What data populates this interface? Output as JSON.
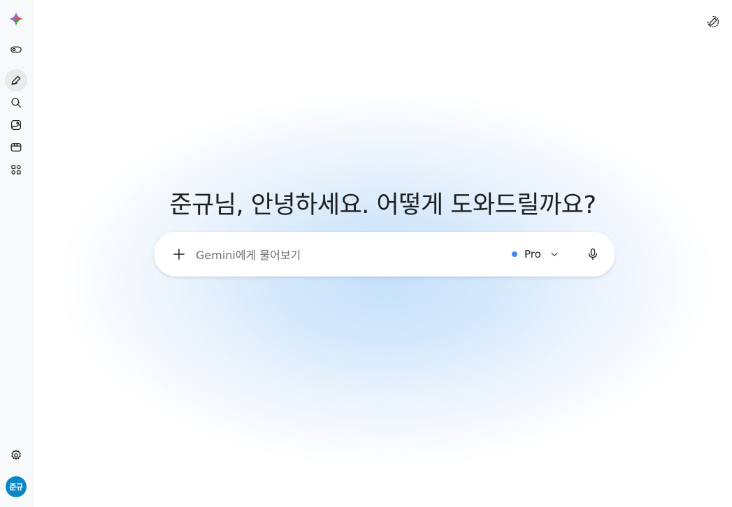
{
  "sidebar": {
    "logo_icon": "gemini-sparkle-icon",
    "items": [
      {
        "icon": "toggle-menu-icon"
      },
      {
        "icon": "new-chat-pencil-icon",
        "active": true
      },
      {
        "icon": "search-icon"
      },
      {
        "icon": "image-icon"
      },
      {
        "icon": "video-icon"
      },
      {
        "icon": "apps-icon"
      }
    ],
    "settings_icon": "gear-icon",
    "avatar_label": "준규",
    "avatar_color": "#0b87c7"
  },
  "header": {
    "temporary_chat_icon": "temporary-chat-icon"
  },
  "main": {
    "greeting": "준규님, 안녕하세요. 어떻게 도와드릴까요?"
  },
  "prompt": {
    "placeholder": "Gemini에게 물어보기",
    "value": "",
    "add_icon": "plus-icon",
    "model_label": "Pro",
    "model_dot_color": "#4285f4",
    "mic_icon": "microphone-icon"
  },
  "colors": {
    "accent": "#4285f4",
    "background_glow": "#c5e0fb"
  }
}
